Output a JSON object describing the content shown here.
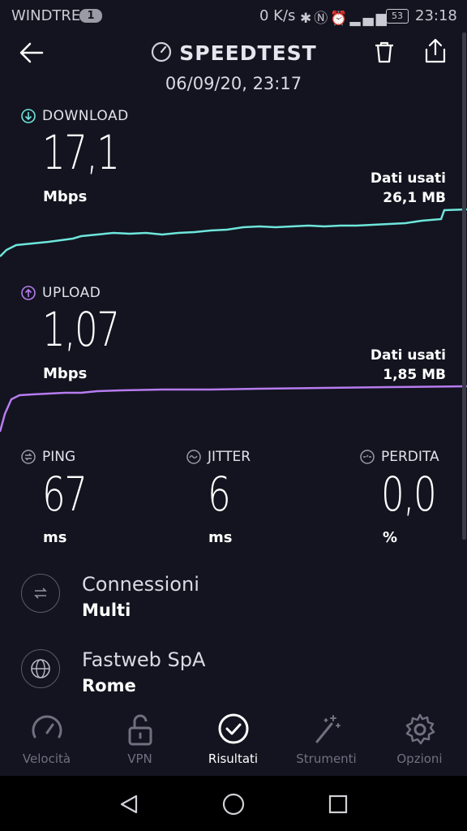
{
  "status_bar": {
    "carrier": "WINDTRE",
    "sim_badge": "1",
    "net_speed": "0 K/s",
    "battery": "53",
    "time": "23:18"
  },
  "header": {
    "title": "SPEEDTEST",
    "datetime": "06/09/20, 23:17"
  },
  "download": {
    "label": "DOWNLOAD",
    "value": "17,1",
    "unit": "Mbps",
    "data_used_label": "Dati usati",
    "data_used_value": "26,1 MB",
    "color": "#6ee6dc"
  },
  "upload": {
    "label": "UPLOAD",
    "value": "1,07",
    "unit": "Mbps",
    "data_used_label": "Dati usati",
    "data_used_value": "1,85 MB",
    "color": "#b77cf0"
  },
  "metrics": {
    "ping": {
      "label": "PING",
      "value": "67",
      "unit": "ms"
    },
    "jitter": {
      "label": "JITTER",
      "value": "6",
      "unit": "ms"
    },
    "loss": {
      "label": "PERDITA",
      "value": "0,0",
      "unit": "%"
    }
  },
  "connections": {
    "title": "Connessioni",
    "value": "Multi"
  },
  "provider": {
    "title": "Fastweb SpA",
    "location": "Rome"
  },
  "nav": {
    "speed": "Velocità",
    "vpn": "VPN",
    "results": "Risultati",
    "tools": "Strumenti",
    "options": "Opzioni"
  }
}
